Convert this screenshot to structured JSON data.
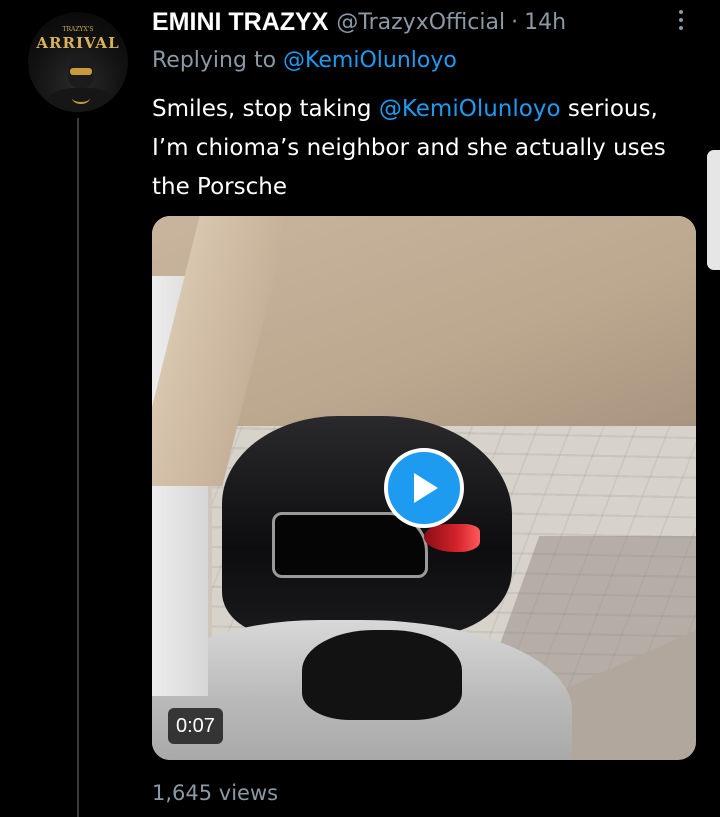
{
  "tweet": {
    "author": {
      "display_name": "EMINI TRAZYX",
      "handle": "@TrazyxOfficial",
      "avatar_text": "ARRIVAL",
      "avatar_small_text": "TRAZYX'S"
    },
    "separator": "·",
    "time": "14h",
    "replying_to": {
      "prefix": "Replying to",
      "mention": "@KemiOlunloyo"
    },
    "text": {
      "part1": "Smiles, stop taking ",
      "mention": "@KemiOlunloyo",
      "part2": " serious, I’m chioma’s neighbor and she actually uses the Porsche"
    },
    "media": {
      "type": "video",
      "duration": "0:07"
    },
    "views": "1,645 views"
  },
  "colors": {
    "background": "#000000",
    "text_primary": "#ffffff",
    "text_secondary": "#8b98a5",
    "accent": "#1d9bf0",
    "thread_line": "#3a3a3a"
  },
  "icons": {
    "more": "more-vertical-icon",
    "play": "play-icon"
  }
}
